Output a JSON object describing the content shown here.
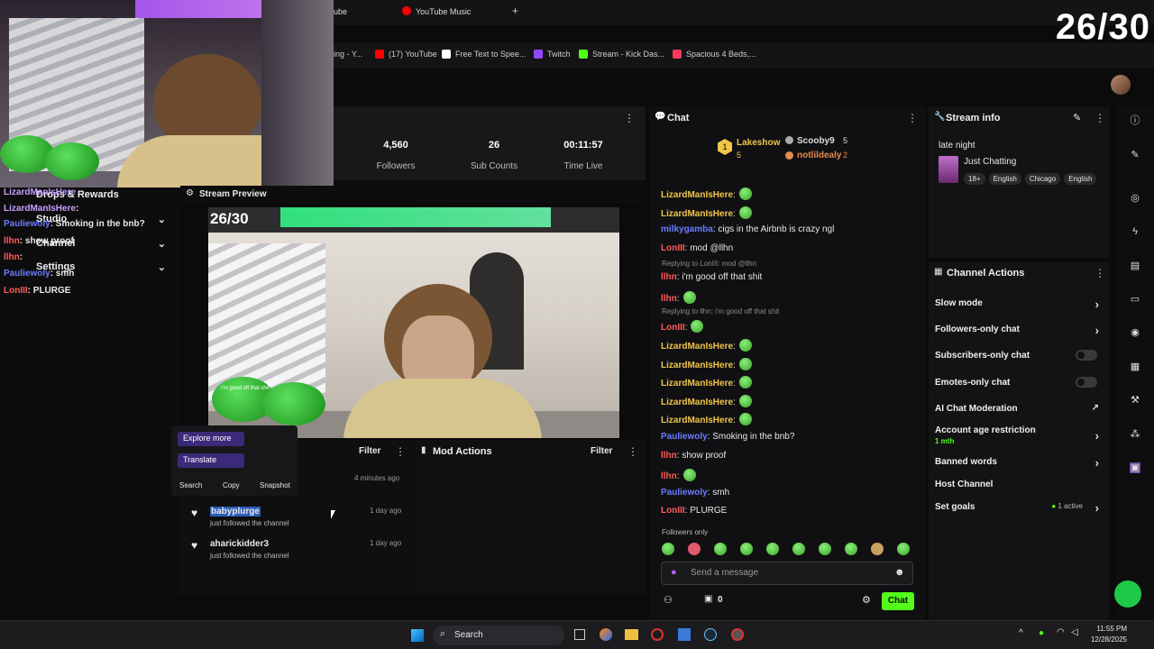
{
  "browser": {
    "tabs": [
      {
        "label": "ube"
      },
      {
        "label": "YouTube Music"
      }
    ],
    "new_tab": "+",
    "bookmarks": [
      {
        "label": "ing - Y...",
        "color": "#e0e0e0"
      },
      {
        "label": "(17) YouTube",
        "color": "#ff0000"
      },
      {
        "label": "Free Text to Spee...",
        "color": "#ffffff"
      },
      {
        "label": "Twitch",
        "color": "#9146ff"
      },
      {
        "label": "Stream - Kick Das...",
        "color": "#53fc18"
      },
      {
        "label": "Spacious 4 Beds,...",
        "color": "#ff385c"
      }
    ]
  },
  "counter": "26/30",
  "webcam_chat": [
    {
      "user": "LizardManIsHere",
      "text": ":",
      "color": "#c3a0ff"
    },
    {
      "user": "Pauliewoly",
      "text": ": Smoking in the bnb?",
      "color": "#6c7bff"
    },
    {
      "user": "llhn",
      "text": ": show proof",
      "color": "#ff5b5b"
    },
    {
      "user": "llhn",
      "text": ":",
      "color": "#ff5b5b"
    },
    {
      "user": "Pauliewoly",
      "text": ": smh",
      "color": "#6c7bff"
    },
    {
      "user": "LonIII",
      "text": ": PLURGE",
      "color": "#ff5b5b"
    }
  ],
  "dashboard_menu": [
    {
      "label": "Drops & Rewards"
    },
    {
      "label": "Studio"
    },
    {
      "label": "Channel"
    },
    {
      "label": "Settings"
    }
  ],
  "stats": [
    {
      "value": "4,560",
      "label": "Followers"
    },
    {
      "value": "26",
      "label": "Sub Counts"
    },
    {
      "value": "00:11:57",
      "label": "Time Live"
    }
  ],
  "preview": {
    "title": "Stream Preview",
    "overlay_counter": "26/30",
    "caption": "I'm good off that shit"
  },
  "activity": {
    "filter": "Filter",
    "context_menu": {
      "explore": "Explore more",
      "translate": "Translate",
      "search": "Search",
      "copy": "Copy",
      "snapshot": "Snapshot"
    },
    "items": [
      {
        "user": "",
        "desc": "",
        "time": "4 minutes ago"
      },
      {
        "user": "babyplurge",
        "desc": "just followed the channel",
        "time": "1 day ago"
      },
      {
        "user": "aharickidder3",
        "desc": "just followed the channel",
        "time": "1 day ago"
      }
    ]
  },
  "mod_actions": {
    "title": "Mod Actions",
    "filter": "Filter"
  },
  "chat": {
    "title": "Chat",
    "leaders": [
      {
        "name": "Lakeshow",
        "count": "5",
        "rank": "1"
      },
      {
        "name": "Scooby9",
        "count": "5"
      },
      {
        "name": "notlildealy",
        "count": "2"
      }
    ],
    "messages": [
      {
        "user": "LizardManIsHere",
        "text": ":",
        "color": "#f1c54a",
        "emote": true
      },
      {
        "user": "LizardManIsHere",
        "text": ":",
        "color": "#f1c54a",
        "emote": true
      },
      {
        "user": "milkygamba",
        "text": ": cigs in the Airbnb is crazy ngl",
        "color": "#6c7bff",
        "emote": false
      },
      {
        "user": "LonIII",
        "text": ": mod @llhn",
        "color": "#ff5b5b",
        "emote": false
      },
      {
        "user": "llhn",
        "text": ": i'm good off that shit",
        "color": "#ff5b5b",
        "emote": false,
        "reply": "Replying to LonIII: mod @llhn"
      },
      {
        "user": "llhn",
        "text": ":",
        "color": "#ff5b5b",
        "emote": true
      },
      {
        "user": "LonIII",
        "text": ":",
        "color": "#ff5b5b",
        "emote": true,
        "reply": "Replying to llhn: i'm good off that shit"
      },
      {
        "user": "LizardManIsHere",
        "text": ":",
        "color": "#f1c54a",
        "emote": true
      },
      {
        "user": "LizardManIsHere",
        "text": ":",
        "color": "#f1c54a",
        "emote": true
      },
      {
        "user": "LizardManIsHere",
        "text": ":",
        "color": "#f1c54a",
        "emote": true
      },
      {
        "user": "LizardManIsHere",
        "text": ":",
        "color": "#f1c54a",
        "emote": true
      },
      {
        "user": "LizardManIsHere",
        "text": ":",
        "color": "#f1c54a",
        "emote": true
      },
      {
        "user": "Pauliewoly",
        "text": ": Smoking in the bnb?",
        "color": "#6c7bff",
        "emote": false
      },
      {
        "user": "llhn",
        "text": ": show proof",
        "color": "#ff5b5b",
        "emote": false
      },
      {
        "user": "llhn",
        "text": ":",
        "color": "#ff5b5b",
        "emote": true
      },
      {
        "user": "Pauliewoly",
        "text": ": smh",
        "color": "#6c7bff",
        "emote": false
      },
      {
        "user": "LonIII",
        "text": ": PLURGE",
        "color": "#ff5b5b",
        "emote": false
      }
    ],
    "followers_only": "Followers only",
    "placeholder": "Send a message",
    "viewer_count": "0",
    "send_label": "Chat"
  },
  "stream_info": {
    "title_label": "Stream info",
    "stream_title": "late night",
    "category": "Just Chatting",
    "tags": [
      "18+",
      "English",
      "Chicago",
      "English"
    ]
  },
  "channel_actions": {
    "title": "Channel Actions",
    "rows": [
      {
        "label": "Slow mode",
        "control": "arrow"
      },
      {
        "label": "Followers-only chat",
        "control": "arrow"
      },
      {
        "label": "Subscribers-only chat",
        "control": "toggle"
      },
      {
        "label": "Emotes-only chat",
        "control": "toggle"
      },
      {
        "label": "AI Chat Moderation",
        "control": "external"
      },
      {
        "label": "Account age restriction",
        "sub": "1 mth",
        "control": "arrow"
      },
      {
        "label": "Banned words",
        "control": "arrow"
      },
      {
        "label": "Host Channel",
        "control": "none"
      },
      {
        "label": "Set goals",
        "badge": "1 active",
        "control": "arrow"
      }
    ]
  },
  "taskbar": {
    "search": "Search",
    "time": "11:55 PM",
    "date": "12/28/2025"
  },
  "colors": {
    "kick_green": "#53fc18",
    "panel": "#131315",
    "accent_purple": "#3b2a7a"
  }
}
